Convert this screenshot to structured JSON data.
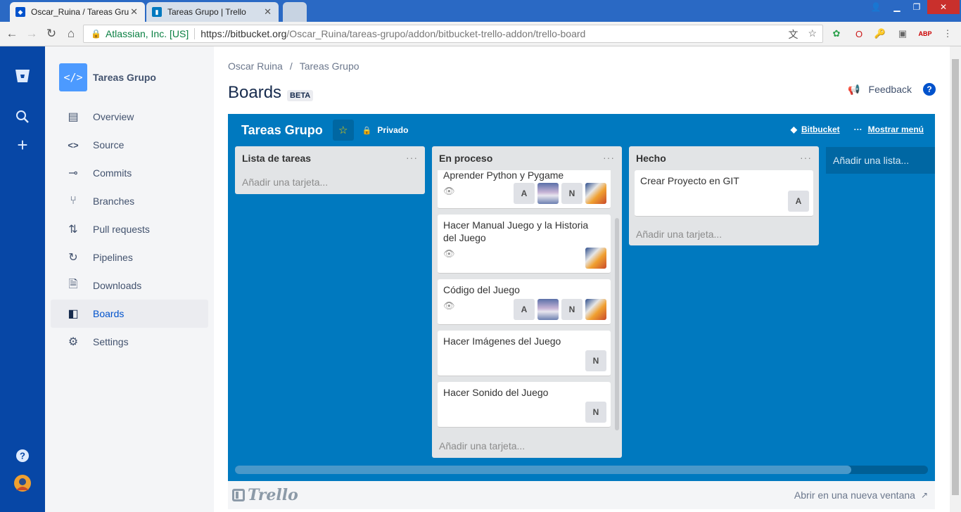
{
  "browser": {
    "tabs": [
      {
        "title": "Oscar_Ruina / Tareas Gru",
        "close": "✕"
      },
      {
        "title": "Tareas Grupo | Trello",
        "close": "✕"
      }
    ],
    "address": {
      "secure_label": "Atlassian, Inc. [US]",
      "url_host": "https://bitbucket.org",
      "url_path": "/Oscar_Ruina/tareas-grupo/addon/bitbucket-trello-addon/trello-board"
    }
  },
  "sidebar": {
    "repo_name": "Tareas Grupo",
    "items": [
      {
        "label": "Overview"
      },
      {
        "label": "Source"
      },
      {
        "label": "Commits"
      },
      {
        "label": "Branches"
      },
      {
        "label": "Pull requests"
      },
      {
        "label": "Pipelines"
      },
      {
        "label": "Downloads"
      },
      {
        "label": "Boards"
      },
      {
        "label": "Settings"
      }
    ],
    "active": "Boards"
  },
  "header": {
    "breadcrumb": [
      "Oscar Ruina",
      "Tareas Grupo"
    ],
    "title": "Boards",
    "badge": "BETA",
    "feedback": "Feedback"
  },
  "board": {
    "title": "Tareas Grupo",
    "privacy": "Privado",
    "bitbucket_link": "Bitbucket",
    "menu_link": "Mostrar menú",
    "add_list": "Añadir una lista...",
    "lists": [
      {
        "name": "Lista de tareas",
        "add_card": "Añadir una tarjeta...",
        "cards": []
      },
      {
        "name": "En proceso",
        "add_card": "Añadir una tarjeta...",
        "cards": [
          {
            "title": "Aprender Python y Pygame",
            "watch": true,
            "members": [
              "A",
              "img1",
              "N",
              "img2"
            ]
          },
          {
            "title": "Hacer Manual Juego y la Historia del Juego",
            "watch": true,
            "members": [
              "img2"
            ]
          },
          {
            "title": "Código del Juego",
            "watch": true,
            "members": [
              "A",
              "img1",
              "N",
              "img2"
            ]
          },
          {
            "title": "Hacer Imágenes del Juego",
            "watch": false,
            "members": [
              "N"
            ]
          },
          {
            "title": "Hacer Sonido del Juego",
            "watch": false,
            "members": [
              "N"
            ]
          }
        ]
      },
      {
        "name": "Hecho",
        "add_card": "Añadir una tarjeta...",
        "cards": [
          {
            "title": "Crear Proyecto en GIT",
            "watch": false,
            "members": [
              "A"
            ]
          }
        ]
      }
    ]
  },
  "footer": {
    "logo": "Trello",
    "open_new": "Abrir en una nueva ventana"
  },
  "colors": {
    "global_nav": "#0747a6",
    "board_bg": "#0079bf",
    "list_bg": "#e2e4e6"
  }
}
